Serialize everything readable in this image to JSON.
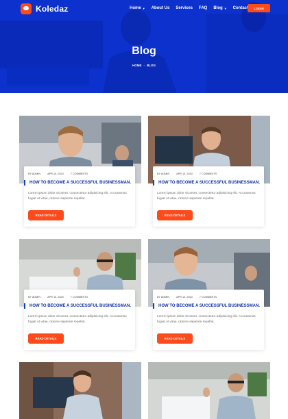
{
  "header": {
    "logo_text": "Koledaz",
    "menu": [
      {
        "label": "Home",
        "has_dropdown": true
      },
      {
        "label": "About Us",
        "has_dropdown": false
      },
      {
        "label": "Services",
        "has_dropdown": false
      },
      {
        "label": "FAQ",
        "has_dropdown": false
      },
      {
        "label": "Blog",
        "has_dropdown": true
      },
      {
        "label": "Contact",
        "has_dropdown": false
      }
    ],
    "login_label": "LOGIN"
  },
  "hero": {
    "title": "Blog",
    "breadcrumb": [
      "HOME",
      "BLOG"
    ]
  },
  "posts": [
    {
      "author": "BY ADMIN",
      "date": "APR 10, 2020",
      "comments": "7 COMMENTS",
      "title": "HOW TO BECOME A SUCCESSFUL BUSINESSMAN.",
      "excerpt": "Lorem ipsum dolor sit amet, consectetur adipisicing elit. Accusamus fugiat ut vitae, ratione sapiente repellat.",
      "button": "READ DETAILS"
    },
    {
      "author": "BY ADMIN",
      "date": "APR 10, 2020",
      "comments": "7 COMMENTS",
      "title": "HOW TO BECOME A SUCCESSFUL BUSINESSMAN.",
      "excerpt": "Lorem ipsum dolor sit amet, consectetur adipisicing elit. Accusamus fugiat ut vitae, ratione sapiente repellat.",
      "button": "READ DETAILS"
    },
    {
      "author": "BY ADMIN",
      "date": "APR 10, 2020",
      "comments": "7 COMMENTS",
      "title": "HOW TO BECOME A SUCCESSFUL BUSINESSMAN.",
      "excerpt": "Lorem ipsum dolor sit amet, consectetur adipisicing elit. Accusamus fugiat ut vitae, ratione sapiente repellat.",
      "button": "READ DETAILS"
    },
    {
      "author": "BY ADMIN",
      "date": "APR 10, 2020",
      "comments": "7 COMMENTS",
      "title": "HOW TO BECOME A SUCCESSFUL BUSINESSMAN.",
      "excerpt": "Lorem ipsum dolor sit amet, consectetur adipisicing elit. Accusamus fugiat ut vitae, ratione sapiente repellat.",
      "button": "READ DETAILS"
    }
  ],
  "colors": {
    "accent": "#ff4a1c",
    "hero_blue": "#1540e0",
    "title_blue": "#0d2ea8"
  }
}
